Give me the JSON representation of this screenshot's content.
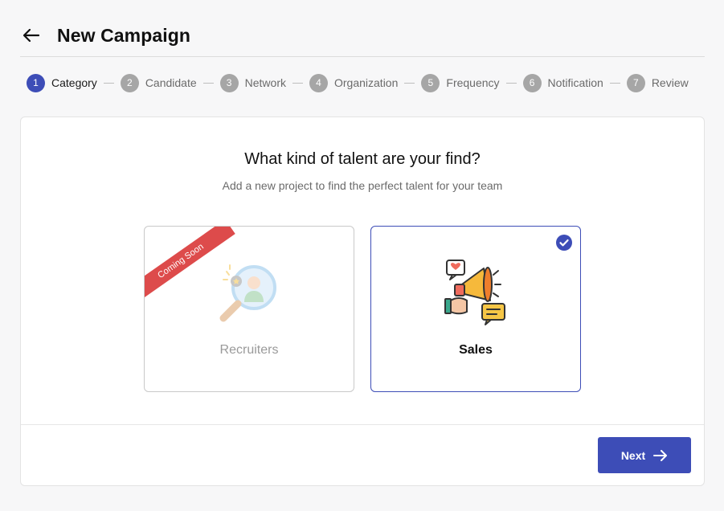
{
  "header": {
    "title": "New Campaign"
  },
  "steps": [
    {
      "num": "1",
      "label": "Category"
    },
    {
      "num": "2",
      "label": "Candidate"
    },
    {
      "num": "3",
      "label": "Network"
    },
    {
      "num": "4",
      "label": "Organization"
    },
    {
      "num": "5",
      "label": "Frequency"
    },
    {
      "num": "6",
      "label": "Notification"
    },
    {
      "num": "7",
      "label": "Review"
    }
  ],
  "main": {
    "question": "What kind of talent are your find?",
    "subtitle": "Add a new project to find the perfect talent for your team",
    "options": [
      {
        "label": "Recruiters",
        "ribbon": "Coming Soon",
        "icon": "recruiter-search-icon"
      },
      {
        "label": "Sales",
        "icon": "megaphone-icon",
        "selected": true
      }
    ]
  },
  "footer": {
    "next_label": "Next"
  },
  "colors": {
    "accent": "#3d4db7",
    "ribbon": "#dd4b4b"
  }
}
